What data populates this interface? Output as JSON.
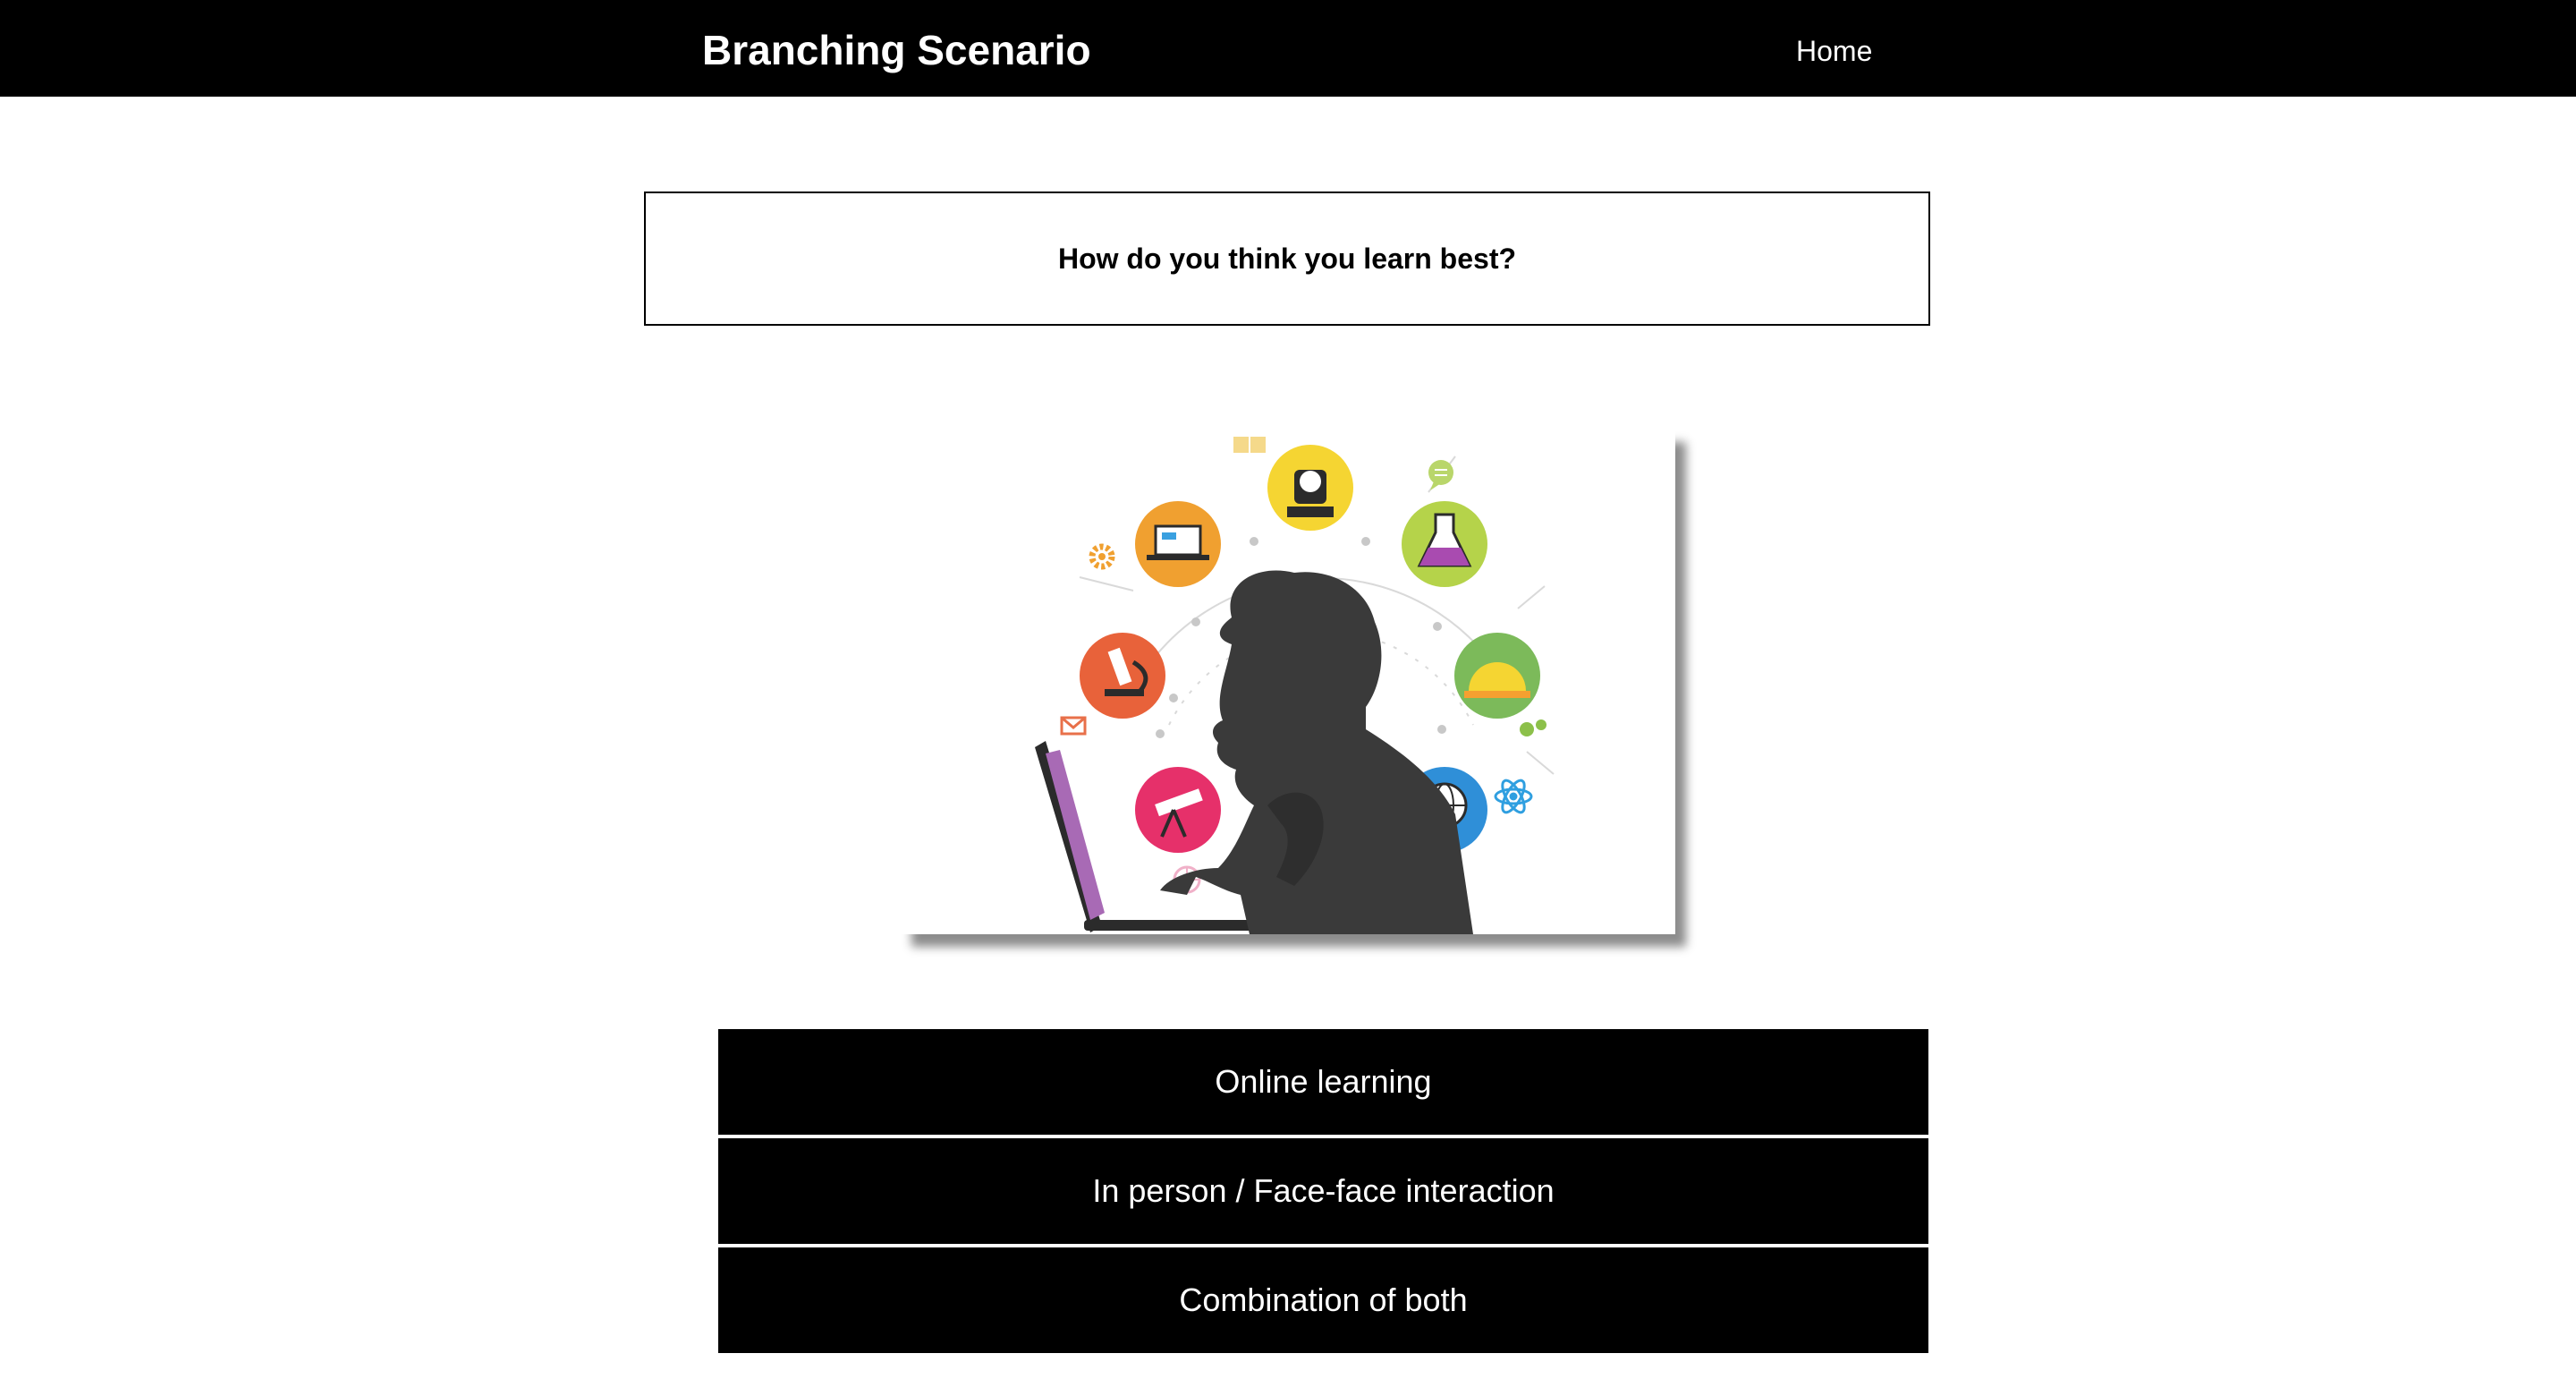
{
  "navbar": {
    "brand": "Branching Scenario",
    "links": [
      {
        "label": "Home"
      }
    ]
  },
  "question": {
    "text": "How do you think you learn best?"
  },
  "illustration": {
    "icons": [
      "book-icon",
      "teacher-icon",
      "chat-bubble-icon",
      "gear-icon",
      "laptop-icon",
      "flask-icon",
      "microscope-icon",
      "protractor-icon",
      "envelope-icon",
      "gears-icon",
      "telescope-icon",
      "globe-icon",
      "atom-icon",
      "basketball-icon"
    ]
  },
  "choices": [
    {
      "label": "Online learning"
    },
    {
      "label": "In person / Face-face interaction"
    },
    {
      "label": "Combination of both"
    }
  ],
  "colors": {
    "navbar_bg": "#000000",
    "button_bg": "#000000",
    "button_text": "#ffffff"
  }
}
